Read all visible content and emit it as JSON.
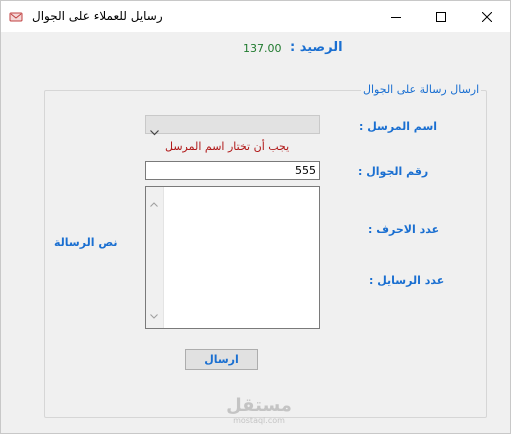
{
  "window": {
    "title": "رسايل للعملاء على الجوال",
    "icons": {
      "app": "app-logo-icon",
      "minimize": "minimize-icon",
      "maximize": "maximize-icon",
      "close": "close-icon"
    }
  },
  "balance": {
    "label": "الرصيد :",
    "value": "137.00"
  },
  "group": {
    "title": "ارسال رسالة على الجوال"
  },
  "form": {
    "sender_label": "اسم المرسل :",
    "sender_selected": "",
    "sender_error": "يجب أن تختار اسم المرسل",
    "mobile_label": "رقم الجوال :",
    "mobile_value": "555",
    "message_label": "نص الرسالة",
    "message_value": "",
    "chars_label": "عدد الاحرف :",
    "messages_label": "عدد الرسايل :",
    "send_label": "ارسال"
  },
  "watermark": {
    "arabic": "مستقل",
    "latin": "mostaql.com"
  },
  "colors": {
    "label_blue": "#1a6fd1",
    "balance_green": "#1f7a2e",
    "error_red": "#b01717"
  }
}
